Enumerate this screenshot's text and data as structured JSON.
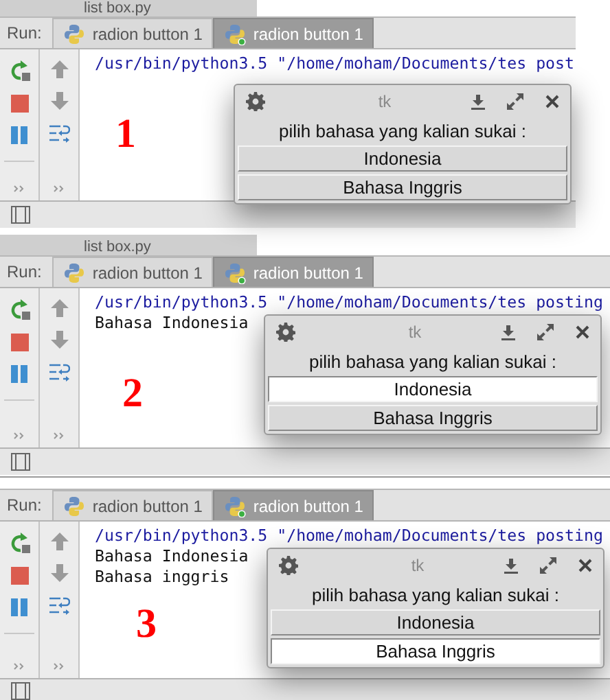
{
  "panels": [
    {
      "file_tab": "list box.py",
      "run_label": "Run:",
      "tabs": [
        {
          "label": "radion button 1",
          "selected": false,
          "running": false
        },
        {
          "label": "radion button 1",
          "selected": true,
          "running": true
        }
      ],
      "console": [
        {
          "kind": "command",
          "text": "/usr/bin/python3.5 \"/home/moham/Documents/tes post"
        }
      ],
      "marker": "1",
      "dialog": {
        "title": "tk",
        "prompt": "pilih bahasa yang kalian sukai :",
        "options": [
          {
            "label": "Indonesia",
            "selected": false
          },
          {
            "label": "Bahasa Inggris",
            "selected": false
          }
        ]
      }
    },
    {
      "file_tab": "list box.py",
      "run_label": "Run:",
      "tabs": [
        {
          "label": "radion button 1",
          "selected": false,
          "running": false
        },
        {
          "label": "radion button 1",
          "selected": true,
          "running": true
        }
      ],
      "console": [
        {
          "kind": "command",
          "text": "/usr/bin/python3.5 \"/home/moham/Documents/tes posting"
        },
        {
          "kind": "output",
          "text": "Bahasa Indonesia"
        }
      ],
      "marker": "2",
      "dialog": {
        "title": "tk",
        "prompt": "pilih bahasa yang kalian sukai :",
        "options": [
          {
            "label": "Indonesia",
            "selected": true
          },
          {
            "label": "Bahasa Inggris",
            "selected": false
          }
        ]
      }
    },
    {
      "run_label": "Run:",
      "tabs": [
        {
          "label": "radion button 1",
          "selected": false,
          "running": false
        },
        {
          "label": "radion button 1",
          "selected": true,
          "running": true
        }
      ],
      "console": [
        {
          "kind": "command",
          "text": "/usr/bin/python3.5 \"/home/moham/Documents/tes posting"
        },
        {
          "kind": "output",
          "text": "Bahasa Indonesia"
        },
        {
          "kind": "output",
          "text": "Bahasa inggris"
        }
      ],
      "marker": "3",
      "dialog": {
        "title": "tk",
        "prompt": "pilih bahasa yang kalian sukai :",
        "options": [
          {
            "label": "Indonesia",
            "selected": false
          },
          {
            "label": "Bahasa Inggris",
            "selected": true
          }
        ]
      }
    }
  ]
}
